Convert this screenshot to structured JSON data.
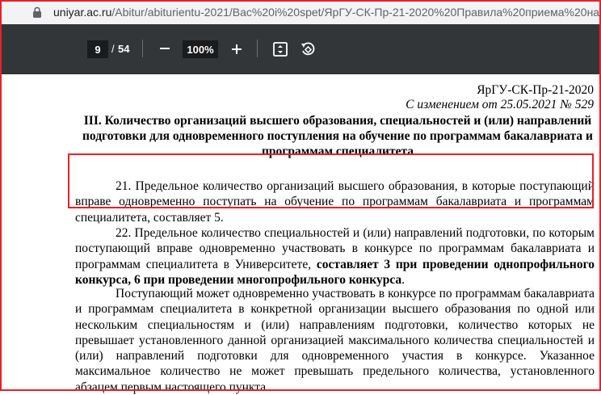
{
  "browser": {
    "url_host": "uniyar.ac.ru",
    "url_path": "/Abitur/abiturientu-2021/Bac%20i%20spet/ЯрГУ-СК-Пр-21-2020%20Правила%20приема%20на"
  },
  "pdf_toolbar": {
    "current_page": "9",
    "separator": "/",
    "total_pages": "54",
    "zoom": "100%"
  },
  "document": {
    "code": "ЯрГУ-СК-Пр-21-2020",
    "change_note": "С изменением от 25.05.2021 № 529",
    "section_title": "III. Количество организаций высшего образования, специальностей и (или) направлений подготовки для одновременного поступления на обучение по программам бакалавриата и программам специалитета",
    "p21": "21. Предельное количество организаций высшего образования, в которые поступающий вправе одновременно поступать на обучение по программам бакалавриата и программам специалитета, составляет 5.",
    "p22_plain": "22. Предельное количество специальностей и (или) направлений подготовки, по которым поступающий вправе одновременно участвовать в конкурсе по программам бакалавриата и программам специалитета в Университете, ",
    "p22_bold": "составляет 3 при проведении однопрофильного конкурса, 6 при проведении многопрофильного конкурса",
    "p22_end": ".",
    "p_rest": "Поступающий может одновременно участвовать в конкурсе по программам бакалавриата и программам специалитета в конкретной организации высшего образования по одной или нескольким специальностям и (или) направлениям подготовки, количество которых не превышает установленного данной организацией максимального количества специальностей и (или) направлений подготовки для одновременного участия в конкурсе. Указанное максимальное количество не может превышать предельного количества, установленного абзацем первым настоящего пункта."
  },
  "colors": {
    "annotation_red": "#e8202a",
    "toolbar_bg": "#323639"
  }
}
